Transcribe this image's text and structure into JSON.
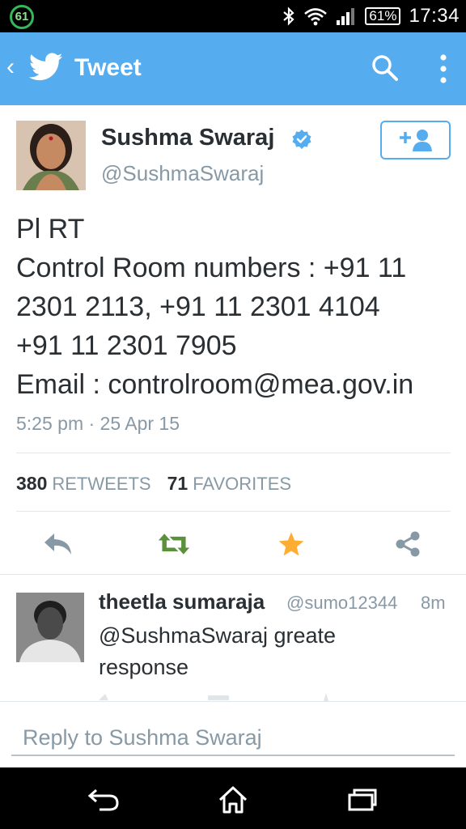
{
  "status_bar": {
    "notification_badge": "61",
    "battery": "61%",
    "time": "17:34",
    "icons": [
      "bluetooth-icon",
      "wifi-icon",
      "signal-icon",
      "battery-icon"
    ]
  },
  "app_bar": {
    "title": "Tweet",
    "icons": [
      "back-icon",
      "twitter-bird-icon",
      "search-icon",
      "more-vert-icon"
    ],
    "color": "#55acee"
  },
  "tweet": {
    "author_name": "Sushma Swaraj",
    "author_handle": "@SushmaSwaraj",
    "verified": true,
    "text_lines": [
      "Pl RT",
      "Control Room numbers : +91 11",
      "2301 2113, +91 11 2301 4104",
      "+91 11 2301 7905",
      "Email : controlroom@mea.gov.in"
    ],
    "timestamp": "5:25 pm · 25 Apr 15",
    "retweets_count": "380",
    "retweets_label": "RETWEETS",
    "favorites_count": "71",
    "favorites_label": "FAVORITES",
    "action_icons": [
      "reply-icon",
      "retweet-icon",
      "favorite-star-icon",
      "share-icon"
    ],
    "retweet_color": "#5c913b",
    "favorite_color": "#ffac33"
  },
  "reply": {
    "author_name": "theetla sumaraja",
    "author_handle": "@sumo12344",
    "time": "8m",
    "text_lines": [
      "@SushmaSwaraj greate",
      "response"
    ]
  },
  "reply_box": {
    "placeholder": "Reply to Sushma Swaraj"
  },
  "nav_bar": {
    "icons": [
      "back-nav-icon",
      "home-nav-icon",
      "recents-nav-icon"
    ]
  }
}
